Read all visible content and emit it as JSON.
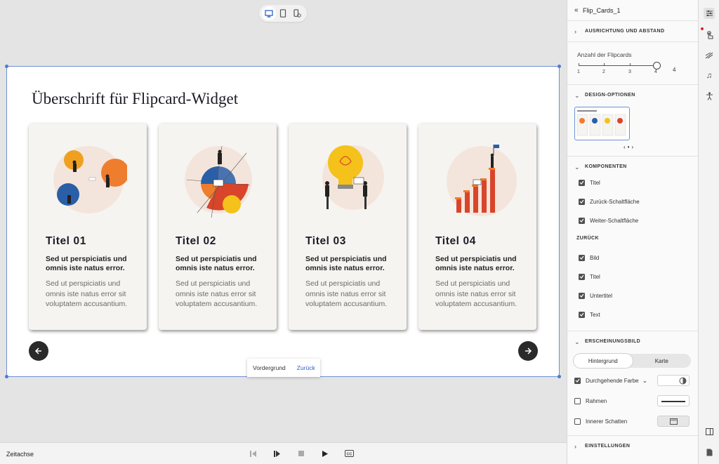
{
  "stage": {
    "title": "Überschrift für Flipcard-Widget",
    "cards": [
      {
        "title": "Titel 01",
        "subtitle": "Sed ut perspiciatis und omnis iste natus error.",
        "text": "Sed ut perspiciatis und omnis iste natus error sit voluptatem accusantium."
      },
      {
        "title": "Titel 02",
        "subtitle": "Sed ut perspiciatis und omnis iste natus error.",
        "text": "Sed ut perspiciatis und omnis iste natus error sit voluptatem accusantium."
      },
      {
        "title": "Titel 03",
        "subtitle": "Sed ut perspiciatis und omnis iste natus error.",
        "text": "Sed ut perspiciatis und omnis iste natus error sit voluptatem accusantium."
      },
      {
        "title": "Titel 04",
        "subtitle": "Sed ut perspiciatis und omnis iste natus error.",
        "text": "Sed ut perspiciatis und omnis iste natus error sit voluptatem accusantium."
      }
    ],
    "face_toggle": {
      "front": "Vordergrund",
      "back": "Zurück"
    }
  },
  "timeline": {
    "label": "Zeitachse"
  },
  "panel": {
    "back_icon": "«",
    "name": "Flip_Cards_1",
    "sections": {
      "alignment": "AUSRICHTUNG UND ABSTAND",
      "design": "DESIGN-OPTIONEN",
      "components": "KOMPONENTEN",
      "appearance": "ERSCHEINUNGSBILD",
      "settings": "EINSTELLUNGEN"
    },
    "slider": {
      "label": "Anzahl der Flipcards",
      "ticks": [
        "1",
        "2",
        "3",
        "4"
      ],
      "value": "4"
    },
    "components": {
      "front_items": [
        "Titel",
        "Zurück-Schaltfläche",
        "Weiter-Schaltfläche"
      ],
      "back_heading": "ZURÜCK",
      "back_items": [
        "Bild",
        "Titel",
        "Untertitel",
        "Text"
      ]
    },
    "appearance": {
      "tabs": [
        "Hintergrund",
        "Karte"
      ],
      "solid_fill": "Durchgehende Farbe",
      "border": "Rahmen",
      "inner_shadow": "Innerer Schatten"
    }
  },
  "colors": {
    "accent": "#4f7ad6",
    "orange": "#ef7d2e",
    "blue": "#2a5fa8",
    "yellow": "#f4c21a",
    "red": "#d8452a",
    "blush": "#f4e5dc"
  }
}
